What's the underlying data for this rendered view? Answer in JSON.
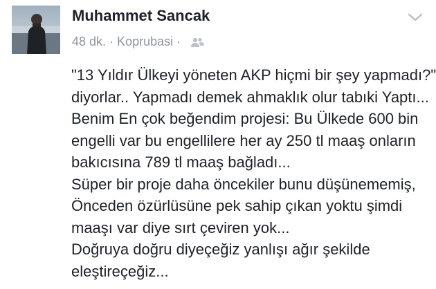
{
  "post": {
    "author_name": "Muhammet Sancak",
    "time_ago": "48 dk.",
    "separator": "·",
    "location": "Koprubasi",
    "audience_icon": "friends-icon",
    "menu_icon": "chevron-down-icon",
    "text_lines": [
      "\"13 Yıldır Ülkeyi yöneten AKP hiçmi bir şey yapmadı?\"",
      "diyorlar.. Yapmadı demek ahmaklık olur tabıki Yaptı...",
      "Benim En çok beğendim projesi: Bu Ülkede 600 bin",
      "engelli var bu engellilere her ay 250 tl maaş onların",
      "bakıcısına 789 tl maaş bağladı...",
      "Süper bir proje daha öncekiler bunu düşünememiş,",
      "Önceden özürlüsüne pek sahip çıkan yoktu şimdi",
      "maaşı var diye sırt çeviren yok...",
      "Doğruya doğru diyeçeğiz yanlışı ağır şekilde",
      "eleştireçeğiz..."
    ]
  },
  "colors": {
    "name": "#1d2129",
    "meta": "#8d949e",
    "text": "#1d2129",
    "icon": "#bec3c9"
  }
}
